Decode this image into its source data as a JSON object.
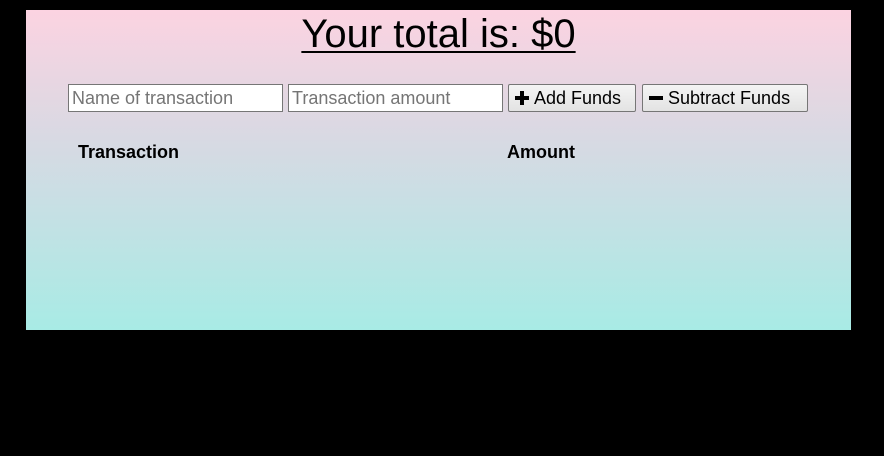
{
  "header": {
    "total_text": "Your total is: $0"
  },
  "form": {
    "name_placeholder": "Name of transaction",
    "amount_placeholder": "Transaction amount",
    "add_label": "Add Funds",
    "subtract_label": "Subtract Funds",
    "add_icon": "plus-icon",
    "subtract_icon": "minus-icon"
  },
  "table": {
    "columns": [
      "Transaction",
      "Amount"
    ],
    "rows": []
  }
}
